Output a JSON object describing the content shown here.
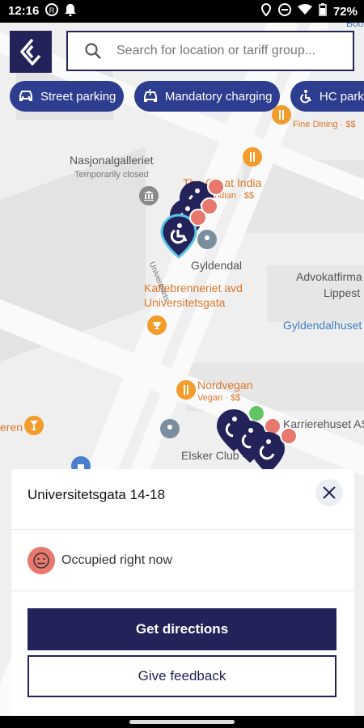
{
  "status_bar": {
    "time": "12:16",
    "battery": "72%"
  },
  "search": {
    "placeholder": "Search for location or tariff group..."
  },
  "chips": [
    {
      "label": "Street parking",
      "icon": "car-icon"
    },
    {
      "label": "Mandatory charging",
      "icon": "charging-car-icon"
    },
    {
      "label": "HC parkin",
      "icon": "wheelchair-icon"
    }
  ],
  "map": {
    "labels": {
      "nasjonalgalleriet": "Nasjonalgalleriet",
      "temporarily_closed": "Temporarily closed",
      "the_great_india": "The Great India",
      "indian_price": "Indian · $$",
      "gyldendal": "Gyldendal",
      "kaffebrenneriet_1": "Kaffebrenneriet avd",
      "kaffebrenneriet_2": "Universitetsgata",
      "advokatfirma_1": "Advokatfirma",
      "advokatfirma_2": "Lippest",
      "gyldendalhuset": "Gyldendalhuset",
      "nordvegan": "Nordvegan",
      "vegan_price": "Vegan · $$",
      "karrierehuset": "Karrierehuset AS",
      "elsker_club": "Elsker Club - Os",
      "fine_dining": "Fine Dining · $$",
      "street_name": "Universitets",
      "eren": "eren",
      "boo": "Boo"
    },
    "colors": {
      "marker": "#23235a",
      "marker_selected_ring": "#5bc4e8",
      "occupied": "#e8776d",
      "free": "#63c463",
      "food_poi": "#f39c2b"
    }
  },
  "sheet": {
    "title": "Universitetsgata 14-18",
    "status": "Occupied right now",
    "primary_button": "Get directions",
    "secondary_button": "Give feedback"
  }
}
